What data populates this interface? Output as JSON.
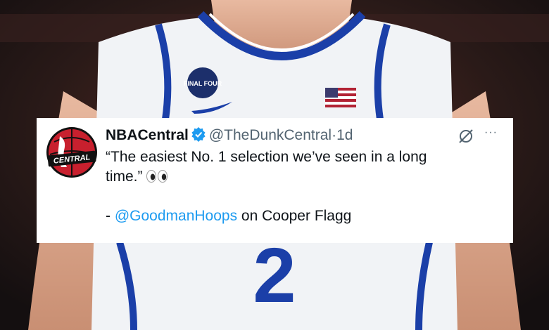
{
  "background": {
    "description_icon": "basketball-player-jersey-photo"
  },
  "tweet": {
    "display_name": "NBACentral",
    "handle": "@TheDunkCentral",
    "separator": "·",
    "time": "1d",
    "quote_line1": "“The easiest No. 1 selection we’ve seen in a long",
    "quote_line2": "time.”",
    "attribution_prefix": "- ",
    "attribution_mention": "@GoodmanHoops",
    "attribution_suffix": " on Cooper Flagg",
    "avatar_text": "CENTRAL",
    "verified_color": "#1d9bf0",
    "more_label": "···"
  },
  "jersey": {
    "number": "2",
    "patch_text": "FINAL FOUR"
  }
}
